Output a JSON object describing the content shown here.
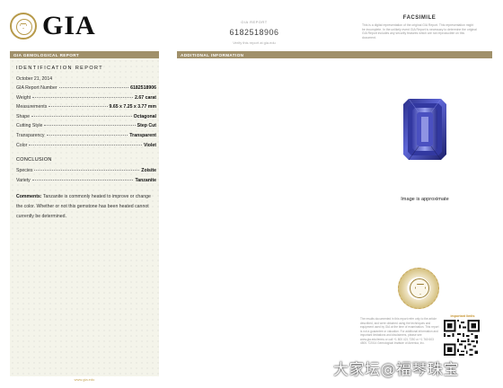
{
  "header": {
    "logo_text": "GIA",
    "report_small_label": "GIA REPORT",
    "report_number": "6182518906",
    "verify_text": "Verify this report at gia.edu",
    "facsimile_title": "FACSIMILE",
    "facsimile_text": "This is a digital representation of the original GIA Report. This representation might be incomplete. In the unlikely event GIA Report is necessary to determine the original GIA Report includes any security features which are not reproducible on this document."
  },
  "bars": {
    "left": "GIA GEMOLOGICAL REPORT",
    "right": "ADDITIONAL INFORMATION"
  },
  "report": {
    "title": "IDENTIFICATION REPORT",
    "date": "October 21, 2014",
    "rows": [
      {
        "label": "GIA Report Number",
        "value": "6182518906"
      },
      {
        "label": "Weight",
        "value": "2.67 carat"
      },
      {
        "label": "Measurements",
        "value": "9.65 x 7.25 x 3.77 mm"
      },
      {
        "label": "Shape",
        "value": "Octagonal"
      },
      {
        "label": "Cutting Style",
        "value": "Step Cut"
      },
      {
        "label": "Transparency",
        "value": "Transparent"
      },
      {
        "label": "Color",
        "value": "Violet"
      }
    ],
    "conclusion_title": "CONCLUSION",
    "conclusion_rows": [
      {
        "label": "Species",
        "value": "Zoisite"
      },
      {
        "label": "Variety",
        "value": "Tanzanite"
      }
    ],
    "comments_label": "Comments:",
    "comments_text": "Tanzanite is commonly heated to improve or change the color. Whether or not this gemstone has been heated cannot currently be determined."
  },
  "footer_url": "www.gia.edu",
  "image_caption": "Image is approximate",
  "fine_print": "The results documented in this report refer only to the article described, and were obtained using the techniques and equipment used by GIA at the time of examination. This report is not a guarantee or valuation. For additional information and important limitations and disclaimers, please see www.gia.edu/terms or call +1 800 421 7250 or +1 760 603 4500. ©2014 Gemological Institute of America, Inc.",
  "qr_label": "important limits",
  "watermark": "大家坛@福琴珠宝",
  "colors": {
    "bar": "#a0906a",
    "panel": "#f4f4ea",
    "gold": "#c7a75a"
  },
  "icons": {
    "logo_seal": "gia-seal-icon",
    "gem": "tanzanite-gem-image",
    "seal": "gia-gold-seal-icon",
    "qr": "qr-code-icon"
  }
}
